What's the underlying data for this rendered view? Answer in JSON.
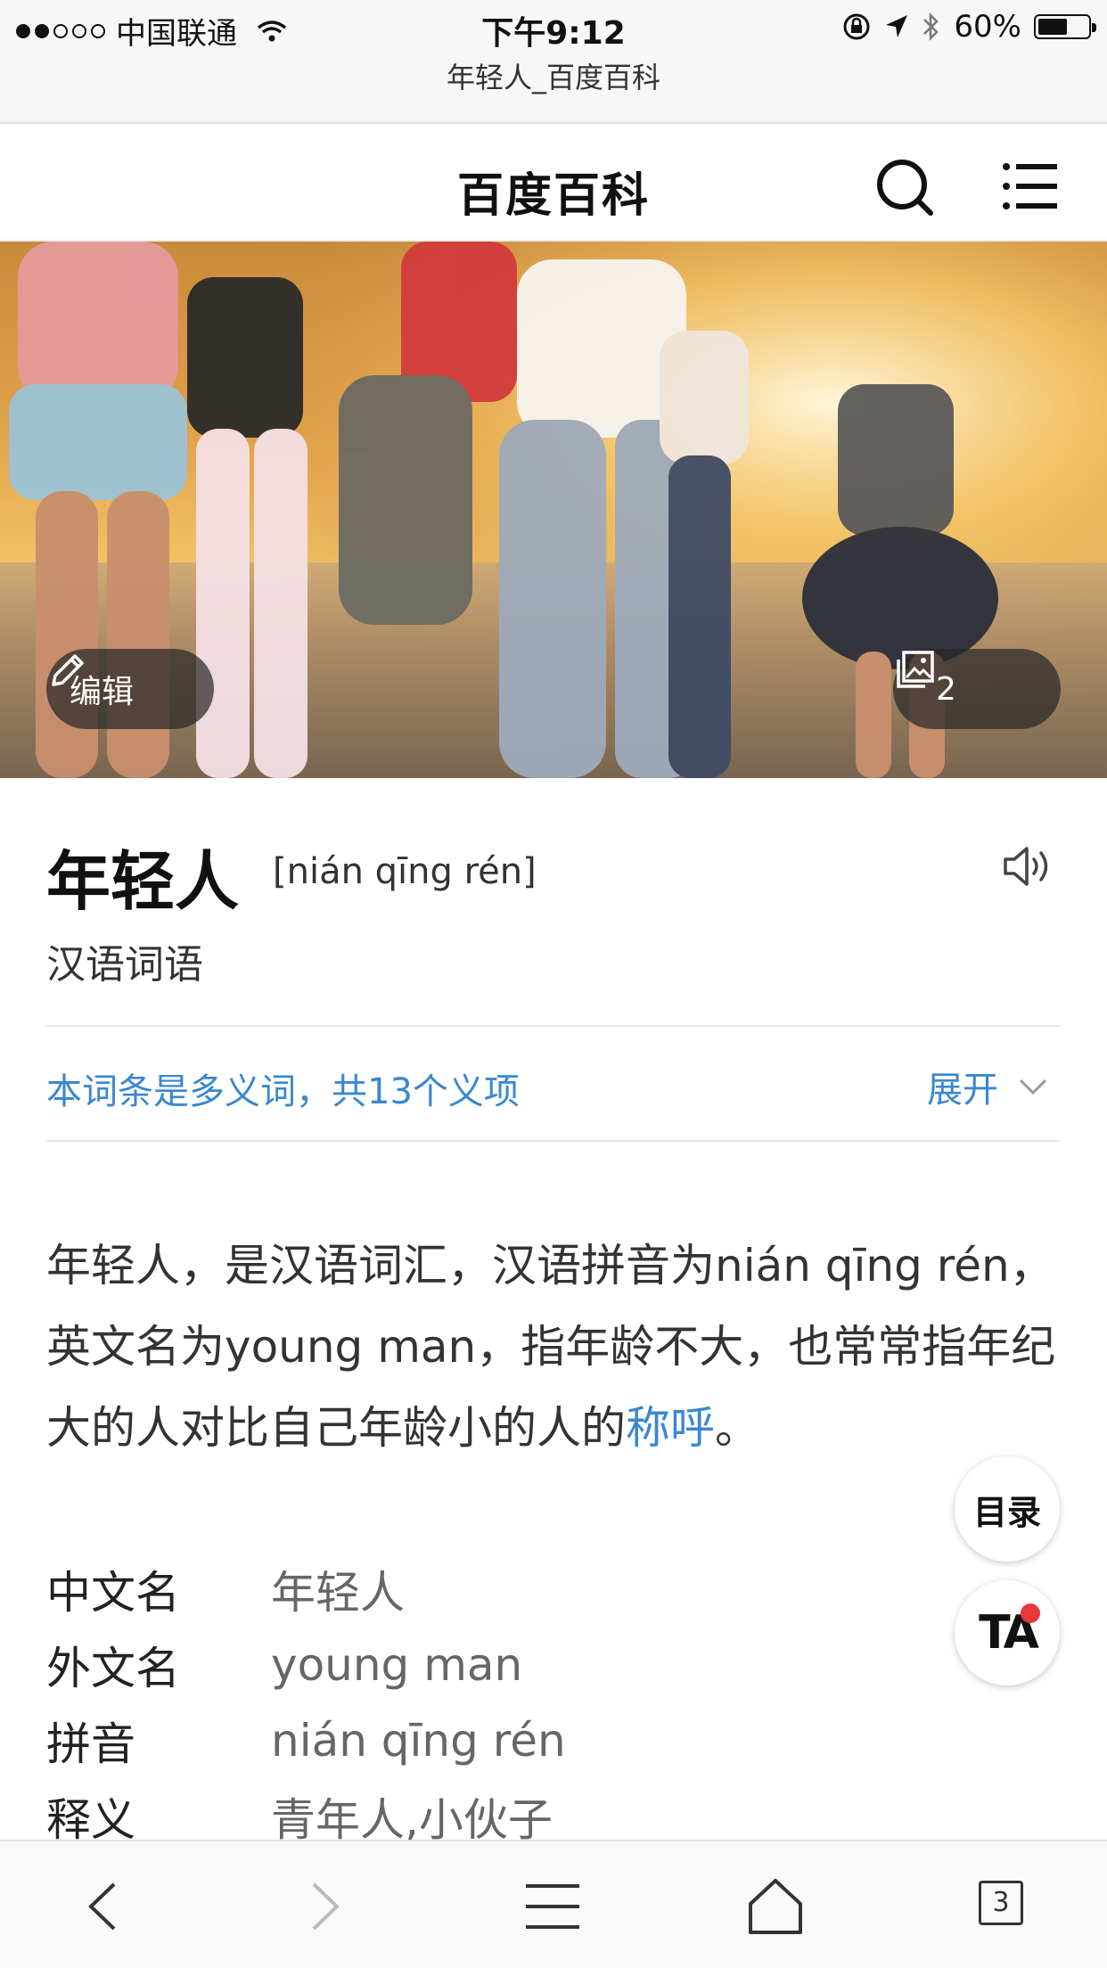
{
  "status_bar": {
    "carrier": "中国联通",
    "time": "下午9:12",
    "battery": "60%",
    "battery_level": 0.6,
    "icons": [
      "signal-icon",
      "wifi-icon",
      "rotation-lock-icon",
      "location-icon",
      "bluetooth-icon",
      "battery-icon"
    ]
  },
  "browser": {
    "page_title": "年轻人_百度百科",
    "open_tabs": "3",
    "toolbar_icons": [
      "back-icon",
      "forward-icon",
      "menu-icon",
      "home-icon",
      "tabs-icon"
    ]
  },
  "header": {
    "title": "百度百科",
    "icons": [
      "search-icon",
      "hamburger-menu-icon"
    ]
  },
  "hero": {
    "edit_label": "编辑",
    "gallery_count": "2"
  },
  "entry": {
    "title": "年轻人",
    "pinyin": "[nián qīng rén]",
    "subtitle": "汉语词语",
    "polysemy_note": "本词条是多义词，共13个义项",
    "expand_label": "展开",
    "summary_before": "年轻人，是汉语词汇，汉语拼音为nián qīng rén，英文名为young man，指年龄不大，也常常指年纪大的人对比自己年龄小的人的",
    "summary_link": "称呼",
    "summary_after": "。"
  },
  "info_table": [
    {
      "key": "中文名",
      "value": "年轻人"
    },
    {
      "key": "外文名",
      "value": "young man"
    },
    {
      "key": "拼音",
      "value": "nián qīng rén"
    },
    {
      "key": "释义",
      "value": "青年人,小伙子"
    }
  ],
  "float_buttons": {
    "toc_label": "目录",
    "ta_label": "TA"
  },
  "colors": {
    "link": "#3a87cf",
    "notification_dot": "#e8383d"
  }
}
